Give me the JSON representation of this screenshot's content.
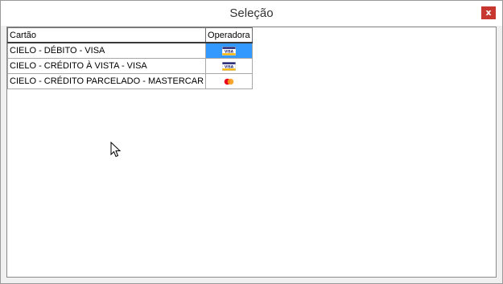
{
  "window": {
    "title": "Seleção",
    "close_label": "x"
  },
  "table": {
    "columns": [
      "Cartão",
      "Operadora"
    ],
    "rows": [
      {
        "cartao": "CIELO - DÉBITO - VISA",
        "operadora_icon": "visa-icon",
        "selected": true
      },
      {
        "cartao": "CIELO - CRÉDITO À VISTA - VISA",
        "operadora_icon": "visa-icon",
        "selected": false
      },
      {
        "cartao": "CIELO - CRÉDITO PARCELADO - MASTERCAR",
        "operadora_icon": "mastercard-icon",
        "selected": false
      }
    ],
    "selection_color": "#3399ff"
  },
  "icons": {
    "visa_text": "VISA"
  }
}
